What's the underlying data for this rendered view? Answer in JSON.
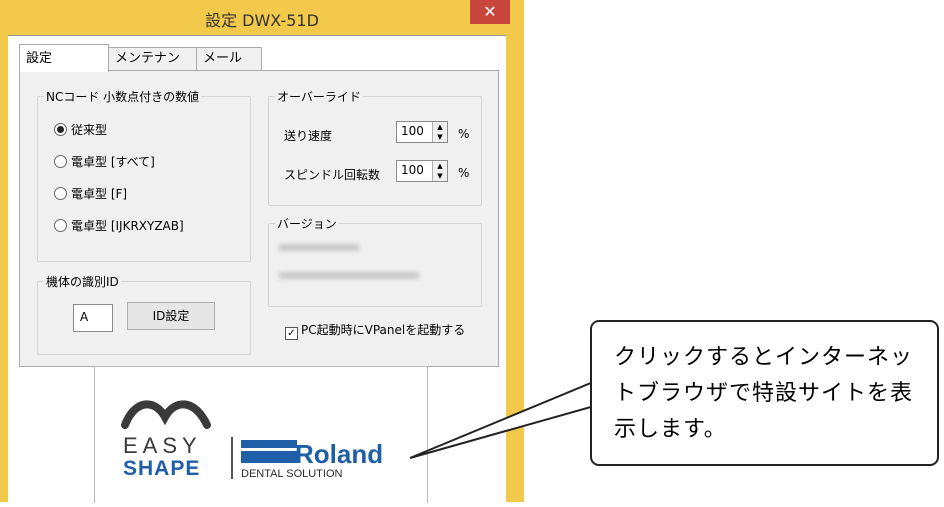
{
  "window": {
    "title": "設定 DWX-51D",
    "close_glyph": "✕"
  },
  "tabs": [
    {
      "label": "設定"
    },
    {
      "label": "メンテナンス"
    },
    {
      "label": "メール"
    }
  ],
  "nc_group": {
    "title": "NCコード 小数点付きの数値",
    "options": [
      {
        "label": "従来型",
        "selected": true
      },
      {
        "label": "電卓型 [すべて]",
        "selected": false
      },
      {
        "label": "電卓型 [F]",
        "selected": false
      },
      {
        "label": "電卓型 [IJKRXYZAB]",
        "selected": false
      }
    ]
  },
  "override_group": {
    "title": "オーバーライド",
    "feed_label": "送り速度",
    "feed_value": "100",
    "spindle_label": "スピンドル回転数",
    "spindle_value": "100",
    "unit": "%"
  },
  "version_group": {
    "title": "バージョン"
  },
  "id_group": {
    "title": "機体の識別ID",
    "id_value": "A",
    "button_label": "ID設定"
  },
  "startup_checkbox": {
    "label": "PC起動時にVPanelを起動する",
    "checked": true
  },
  "logo": {
    "easy": "EASY",
    "shape": "SHAPE",
    "roland": "Roland",
    "dental": "DENTAL SOLUTION",
    "brand_color": "#1f5fa8"
  },
  "callout": {
    "text": "クリックするとインターネットブラウザで特設サイトを表示します。"
  }
}
